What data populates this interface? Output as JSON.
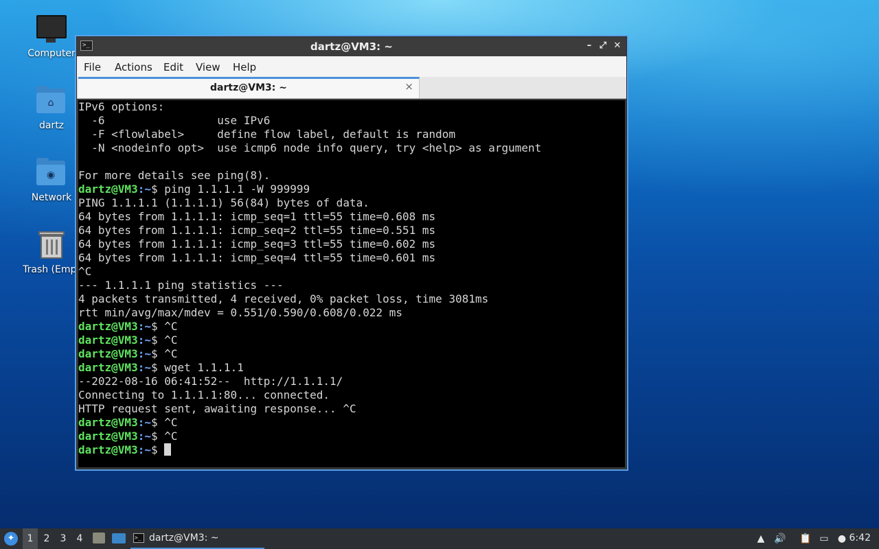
{
  "desktop": {
    "icons": [
      {
        "label": "Computer",
        "icon": "computer-icon"
      },
      {
        "label": "dartz",
        "icon": "home-folder-icon"
      },
      {
        "label": "Network",
        "icon": "network-folder-icon"
      },
      {
        "label": "Trash (Empt",
        "icon": "trash-icon"
      }
    ]
  },
  "window": {
    "title": "dartz@VM3: ~",
    "menu": [
      "File",
      "Actions",
      "Edit",
      "View",
      "Help"
    ],
    "tab": {
      "title": "dartz@VM3: ~",
      "close": "×"
    },
    "controls": {
      "minimize": "–",
      "maximize": "⤢",
      "close": "✕"
    }
  },
  "terminal": {
    "prompt_user": "dartz@VM3",
    "prompt_path": ":~",
    "prompt_symbol": "$ ",
    "lines": [
      {
        "type": "out",
        "text": "IPv6 options:"
      },
      {
        "type": "out",
        "text": "  -6                 use IPv6"
      },
      {
        "type": "out",
        "text": "  -F <flowlabel>     define flow label, default is random"
      },
      {
        "type": "out",
        "text": "  -N <nodeinfo opt>  use icmp6 node info query, try <help> as argument"
      },
      {
        "type": "out",
        "text": ""
      },
      {
        "type": "out",
        "text": "For more details see ping(8)."
      },
      {
        "type": "cmd",
        "text": "ping 1.1.1.1 -W 999999"
      },
      {
        "type": "out",
        "text": "PING 1.1.1.1 (1.1.1.1) 56(84) bytes of data."
      },
      {
        "type": "out",
        "text": "64 bytes from 1.1.1.1: icmp_seq=1 ttl=55 time=0.608 ms"
      },
      {
        "type": "out",
        "text": "64 bytes from 1.1.1.1: icmp_seq=2 ttl=55 time=0.551 ms"
      },
      {
        "type": "out",
        "text": "64 bytes from 1.1.1.1: icmp_seq=3 ttl=55 time=0.602 ms"
      },
      {
        "type": "out",
        "text": "64 bytes from 1.1.1.1: icmp_seq=4 ttl=55 time=0.601 ms"
      },
      {
        "type": "out",
        "text": "^C"
      },
      {
        "type": "out",
        "text": "--- 1.1.1.1 ping statistics ---"
      },
      {
        "type": "out",
        "text": "4 packets transmitted, 4 received, 0% packet loss, time 3081ms"
      },
      {
        "type": "out",
        "text": "rtt min/avg/max/mdev = 0.551/0.590/0.608/0.022 ms"
      },
      {
        "type": "cmd",
        "text": "^C"
      },
      {
        "type": "cmd",
        "text": "^C"
      },
      {
        "type": "cmd",
        "text": "^C"
      },
      {
        "type": "cmd",
        "text": "wget 1.1.1.1"
      },
      {
        "type": "out",
        "text": "--2022-08-16 06:41:52--  http://1.1.1.1/"
      },
      {
        "type": "out",
        "text": "Connecting to 1.1.1.1:80... connected."
      },
      {
        "type": "out",
        "text": "HTTP request sent, awaiting response... ^C"
      },
      {
        "type": "cmd",
        "text": "^C"
      },
      {
        "type": "cmd",
        "text": "^C"
      },
      {
        "type": "cmd",
        "text": "",
        "cursor": true
      }
    ]
  },
  "taskbar": {
    "workspaces": [
      "1",
      "2",
      "3",
      "4"
    ],
    "active_workspace": "1",
    "task": {
      "label": "dartz@VM3: ~"
    },
    "clock": "6:42",
    "tray": [
      "updates-icon",
      "volume-icon",
      "clipboard-icon",
      "network-wired-icon",
      "notification-icon"
    ]
  }
}
